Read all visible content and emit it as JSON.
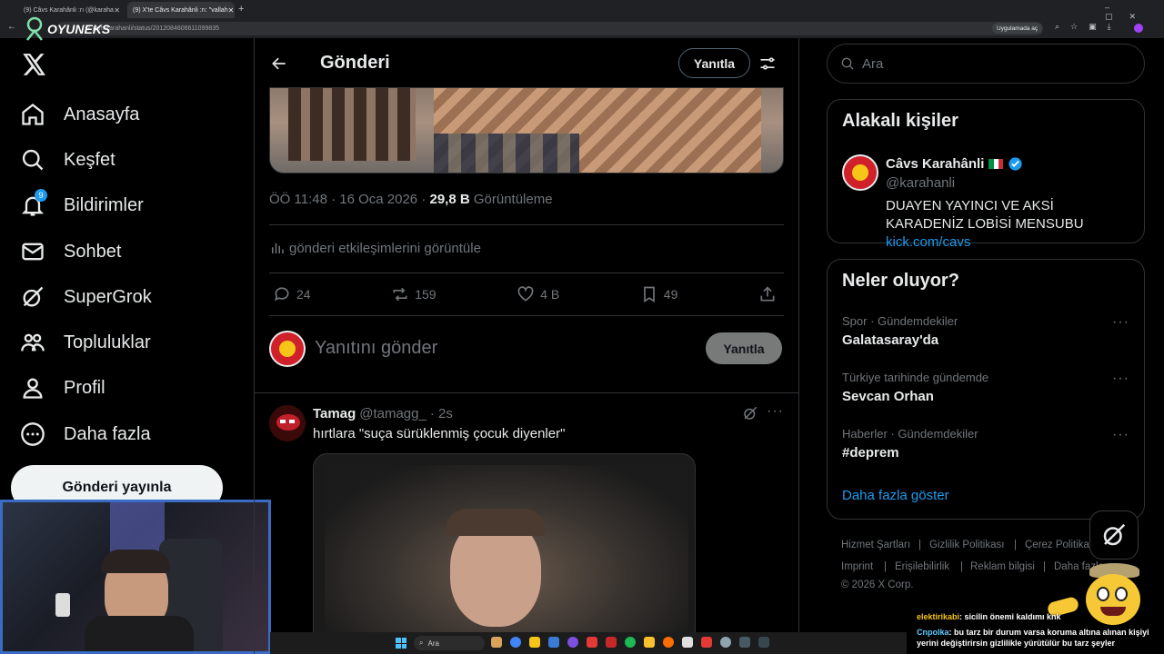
{
  "browser": {
    "tabs": [
      {
        "label": "(9) Câvs Karahânli :rı (@karaha"
      },
      {
        "label": "(9) X'te Câvs Karahânli :rı: \"vallah"
      }
    ],
    "url": "x.com/karahanli/status/2012084606611099835",
    "open_in_app": "Uygulamada aç",
    "overlay_logo": "OYUNEKS"
  },
  "sidebar": {
    "items": [
      {
        "label": "Anasayfa",
        "icon": "home-icon"
      },
      {
        "label": "Keşfet",
        "icon": "search-icon"
      },
      {
        "label": "Bildirimler",
        "icon": "bell-icon",
        "badge": "9"
      },
      {
        "label": "Sohbet",
        "icon": "mail-icon"
      },
      {
        "label": "SuperGrok",
        "icon": "grok-icon"
      },
      {
        "label": "Topluluklar",
        "icon": "communities-icon"
      },
      {
        "label": "Profil",
        "icon": "profile-icon"
      },
      {
        "label": "Daha fazla",
        "icon": "more-icon"
      }
    ],
    "post_button": "Gönderi yayınla"
  },
  "header": {
    "title": "Gönderi",
    "reply_button": "Yanıtla"
  },
  "post": {
    "time": "ÖÖ 11:48 · 16 Oca 2026 · ",
    "views_count": "29,8 B",
    "views_label": " Görüntüleme",
    "engagements": "gönderi etkileşimlerini görüntüle",
    "stats": {
      "replies": "24",
      "reposts": "159",
      "likes": "4 B",
      "bookmarks": "49"
    }
  },
  "reply_box": {
    "placeholder": "Yanıtını gönder",
    "button": "Yanıtla"
  },
  "comment": {
    "name": "Tamag",
    "handle": "@tamagg_",
    "time": "· 2s",
    "text": "hırtlara \"suça sürüklenmiş çocuk diyenler\""
  },
  "right": {
    "search_placeholder": "Ara",
    "related": {
      "title": "Alakalı kişiler",
      "name": "Câvs Karahânli",
      "handle": "@karahanli",
      "bio": "DUAYEN YAYINCI VE AKSİ KARADENİZ LOBİSİ MENSUBU ",
      "bio_link": "kick.com/cavs"
    },
    "trends": {
      "title": "Neler oluyor?",
      "items": [
        {
          "meta": "Spor · Gündemdekiler",
          "title": "Galatasaray'da"
        },
        {
          "meta": "Türkiye tarihinde gündemde",
          "title": "Sevcan Orhan"
        },
        {
          "meta": "Haberler · Gündemdekiler",
          "title": "#deprem"
        }
      ],
      "more": "Daha fazla göster"
    },
    "footer": {
      "links": [
        "Hizmet Şartları",
        "Gizlilik Politikası",
        "Çerez Politikası",
        "Imprint",
        "Erişilebilirlik",
        "Reklam bilgisi",
        "Daha fazla"
      ],
      "copyright": "© 2026 X Corp."
    }
  },
  "chat": {
    "messages": [
      {
        "user": "elektirikabi",
        "text": ": sicilin önemi kaldımı knk"
      },
      {
        "user": "Cnpolka",
        "text": ": bu tarz bir durum varsa koruma altına alınan kişiyi yerini değiştirirsin gizlilikle yürütülür bu tarz şeyler"
      }
    ]
  },
  "taskbar": {
    "search": "Ara"
  },
  "colors": {
    "accent": "#1d9bf0",
    "background": "#000000",
    "border": "#2f3336",
    "muted": "#71767b"
  }
}
